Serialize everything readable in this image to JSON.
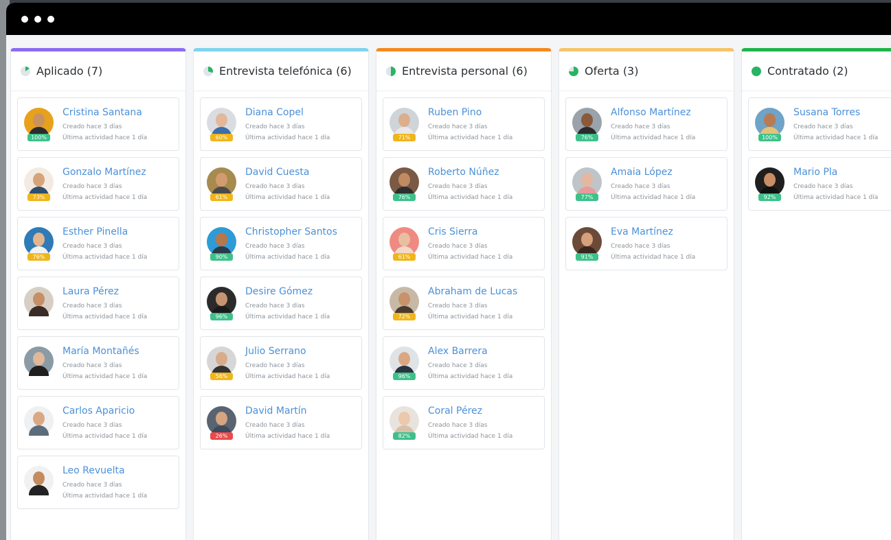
{
  "window": {
    "controls": [
      "close",
      "minimize",
      "maximize"
    ]
  },
  "columns": [
    {
      "title": "Aplicado (7)",
      "color": "#8b6cf0",
      "icon_color": "#28b463",
      "candidates": [
        {
          "name": "Cristina Santana",
          "created": "Creado hace 3 días",
          "activity": "Última actividad hace 1 día",
          "pct": "100%",
          "pct_color": "#3ec08a",
          "avatar_bg": "#e7a11d",
          "skin": "#c9925f",
          "shirt": "#2c2c2c"
        },
        {
          "name": "Gonzalo Martínez",
          "created": "Creado hace 3 días",
          "activity": "Última actividad hace 1 día",
          "pct": "73%",
          "pct_color": "#f0b51b",
          "avatar_bg": "#f3ebe1",
          "skin": "#d7a47a",
          "shirt": "#2f4f6f"
        },
        {
          "name": "Esther Pinella",
          "created": "Creado hace 3 días",
          "activity": "Última actividad hace 1 día",
          "pct": "76%",
          "pct_color": "#f0b51b",
          "avatar_bg": "#2f7ab7",
          "skin": "#e3b48d",
          "shirt": "#f2f2f2"
        },
        {
          "name": "Laura Pérez",
          "created": "Creado hace 3 días",
          "activity": "Última actividad hace 1 día",
          "pct": "",
          "pct_color": "",
          "avatar_bg": "#d8cfc4",
          "skin": "#c78f66",
          "shirt": "#3a2c24"
        },
        {
          "name": "María Montañés",
          "created": "Creado hace 3 días",
          "activity": "Última actividad hace 1 día",
          "pct": "",
          "pct_color": "",
          "avatar_bg": "#8a9ba6",
          "skin": "#e0b89a",
          "shirt": "#1f1f1f"
        },
        {
          "name": "Carlos Aparicio",
          "created": "Creado hace 3 días",
          "activity": "Última actividad hace 1 día",
          "pct": "",
          "pct_color": "",
          "avatar_bg": "#eef0f1",
          "skin": "#dba882",
          "shirt": "#5b6c7a"
        },
        {
          "name": "Leo Revuelta",
          "created": "Creado hace 3 días",
          "activity": "Última actividad hace 1 día",
          "pct": "",
          "pct_color": "",
          "avatar_bg": "#f1f1f1",
          "skin": "#c48b5e",
          "shirt": "#222222"
        }
      ]
    },
    {
      "title": "Entrevista telefónica (6)",
      "color": "#7fd3ef",
      "icon_color": "#28b463",
      "candidates": [
        {
          "name": "Diana Copel",
          "created": "Creado hace 3 días",
          "activity": "Última actividad hace 1 día",
          "pct": "60%",
          "pct_color": "#f0b51b",
          "avatar_bg": "#d9dde2",
          "skin": "#e3b799",
          "shirt": "#3c6ea8"
        },
        {
          "name": "David Cuesta",
          "created": "Creado hace 3 días",
          "activity": "Última actividad hace 1 día",
          "pct": "61%",
          "pct_color": "#f0b51b",
          "avatar_bg": "#a68a4e",
          "skin": "#d39c6f",
          "shirt": "#4a4a4a"
        },
        {
          "name": "Christopher Santos",
          "created": "Creado hace 3 días",
          "activity": "Última actividad hace 1 día",
          "pct": "90%",
          "pct_color": "#3ec08a",
          "avatar_bg": "#2e9bd6",
          "skin": "#b5774c",
          "shirt": "#2b3a4a"
        },
        {
          "name": "Desire Gómez",
          "created": "Creado hace 3 días",
          "activity": "Última actividad hace 1 día",
          "pct": "96%",
          "pct_color": "#3ec08a",
          "avatar_bg": "#2b2b2b",
          "skin": "#c79472",
          "shirt": "#1a1a1a"
        },
        {
          "name": "Julio Serrano",
          "created": "Creado hace 3 días",
          "activity": "Última actividad hace 1 día",
          "pct": "56%",
          "pct_color": "#f0b51b",
          "avatar_bg": "#d6d6d6",
          "skin": "#d8ab8a",
          "shirt": "#333333"
        },
        {
          "name": "David Martín",
          "created": "Creado hace 3 días",
          "activity": "Última actividad hace 1 día",
          "pct": "26%",
          "pct_color": "#e94b4b",
          "avatar_bg": "#5a6470",
          "skin": "#d6a581",
          "shirt": "#3d4c5c"
        }
      ]
    },
    {
      "title": "Entrevista personal (6)",
      "color": "#f58a1f",
      "icon_color": "#28b463",
      "candidates": [
        {
          "name": "Ruben Pino",
          "created": "Creado hace 3 días",
          "activity": "Última actividad hace 1 día",
          "pct": "71%",
          "pct_color": "#f0b51b",
          "avatar_bg": "#cfd4d9",
          "skin": "#dcae8c",
          "shirt": "#e8e8e8"
        },
        {
          "name": "Roberto Núñez",
          "created": "Creado hace 3 días",
          "activity": "Última actividad hace 1 día",
          "pct": "76%",
          "pct_color": "#3ec08a",
          "avatar_bg": "#7a5a45",
          "skin": "#c18a62",
          "shirt": "#2f2f2f"
        },
        {
          "name": "Cris Sierra",
          "created": "Creado hace 3 días",
          "activity": "Última actividad hace 1 día",
          "pct": "61%",
          "pct_color": "#f0b51b",
          "avatar_bg": "#ef8a83",
          "skin": "#e8bfa0",
          "shirt": "#f3d9c9"
        },
        {
          "name": "Abraham de Lucas",
          "created": "Creado hace 3 días",
          "activity": "Última actividad hace 1 día",
          "pct": "72%",
          "pct_color": "#f0b51b",
          "avatar_bg": "#c8b9a6",
          "skin": "#c8926a",
          "shirt": "#4a3b30"
        },
        {
          "name": "Alex Barrera",
          "created": "Creado hace 3 días",
          "activity": "Última actividad hace 1 día",
          "pct": "96%",
          "pct_color": "#3ec08a",
          "avatar_bg": "#dfe3e6",
          "skin": "#d9a882",
          "shirt": "#2b3540"
        },
        {
          "name": "Coral Pérez",
          "created": "Creado hace 3 días",
          "activity": "Última actividad hace 1 día",
          "pct": "82%",
          "pct_color": "#3ec08a",
          "avatar_bg": "#e9e3dd",
          "skin": "#ecc8ad",
          "shirt": "#d8c0a8"
        }
      ]
    },
    {
      "title": "Oferta (3)",
      "color": "#f6c46a",
      "icon_color": "#28b463",
      "candidates": [
        {
          "name": "Alfonso Martínez",
          "created": "Creado hace 3 días",
          "activity": "Última actividad hace 1 día",
          "pct": "76%",
          "pct_color": "#3ec08a",
          "avatar_bg": "#9aa3ab",
          "skin": "#8a5a3a",
          "shirt": "#2c2c2c"
        },
        {
          "name": "Amaia López",
          "created": "Creado hace 3 días",
          "activity": "Última actividad hace 1 día",
          "pct": "77%",
          "pct_color": "#3ec08a",
          "avatar_bg": "#bfc4c9",
          "skin": "#e5b7a0",
          "shirt": "#e89a9a"
        },
        {
          "name": "Eva Martínez",
          "created": "Creado hace 3 días",
          "activity": "Última actividad hace 1 día",
          "pct": "91%",
          "pct_color": "#3ec08a",
          "avatar_bg": "#6b4a3a",
          "skin": "#d6a07a",
          "shirt": "#3a2620"
        }
      ]
    },
    {
      "title": "Contratado (2)",
      "color": "#20b34a",
      "icon_color": "#28b463",
      "candidates": [
        {
          "name": "Susana Torres",
          "created": "Creado hace 3 días",
          "activity": "Última actividad hace 1 día",
          "pct": "100%",
          "pct_color": "#3ec08a",
          "avatar_bg": "#6fa3c8",
          "skin": "#b97b52",
          "shirt": "#e3c27a"
        },
        {
          "name": "Mario Pla",
          "created": "Creado hace 3 días",
          "activity": "Última actividad hace 1 día",
          "pct": "92%",
          "pct_color": "#3ec08a",
          "avatar_bg": "#1f1f1f",
          "skin": "#c98e64",
          "shirt": "#111111"
        }
      ]
    }
  ]
}
